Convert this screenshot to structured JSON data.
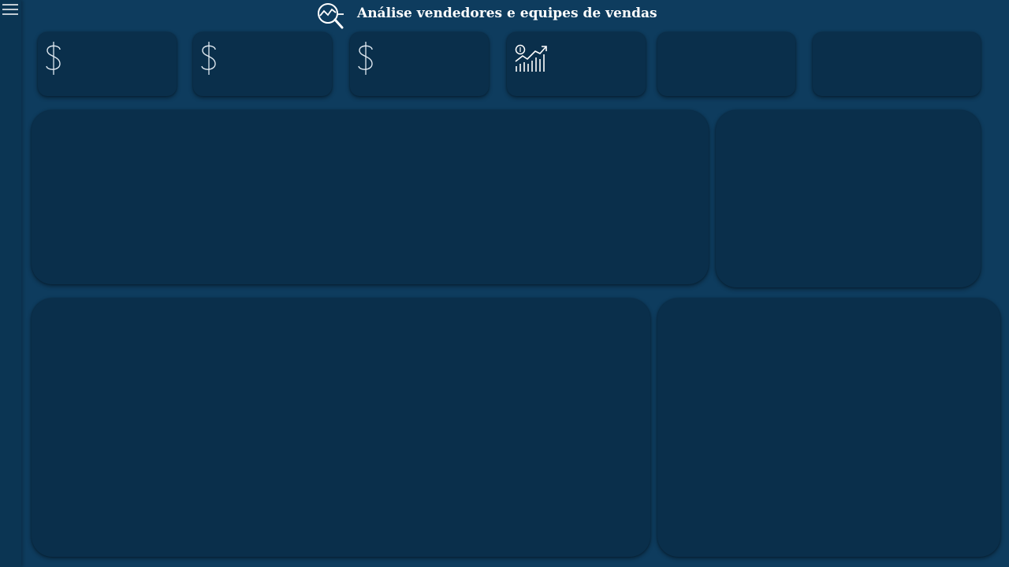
{
  "header": {
    "title": "Análise vendedores e equipes de vendas",
    "icon": "chart-magnifier-icon"
  },
  "sidebar": {
    "menu_icon": "hamburger-menu-icon"
  },
  "kpi_cards": [
    {
      "icon": "dollar-icon"
    },
    {
      "icon": "dollar-icon"
    },
    {
      "icon": "dollar-icon"
    },
    {
      "icon": "growth-chart-icon"
    },
    {
      "icon": ""
    },
    {
      "icon": ""
    }
  ],
  "colors": {
    "background": "#0e3c5e",
    "card": "#0a2f4b",
    "sidebar": "#0b3553",
    "text": "#ffffff"
  }
}
